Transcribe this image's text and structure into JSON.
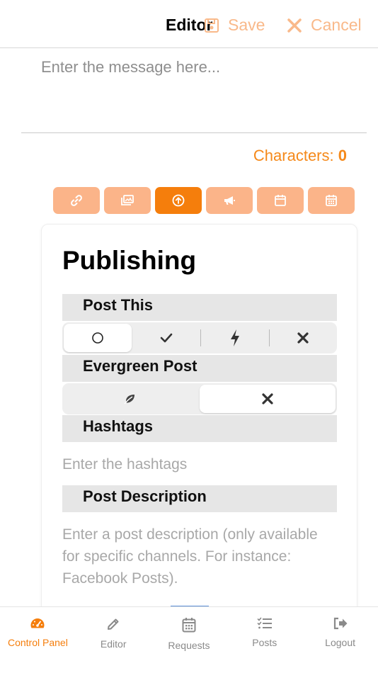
{
  "header": {
    "title": "Editor",
    "save_label": "Save",
    "cancel_label": "Cancel"
  },
  "message": {
    "placeholder": "Enter the message here...",
    "value": ""
  },
  "characters": {
    "label": "Characters:",
    "count": "0"
  },
  "toolbar": {
    "buttons": [
      "link-icon",
      "images-icon",
      "upload-icon",
      "bullhorn-icon",
      "calendar-icon",
      "calendar-grid-icon"
    ],
    "active_index": 2
  },
  "publishing": {
    "title": "Publishing",
    "post_this": {
      "label": "Post This",
      "options": [
        "circle-icon",
        "check-icon",
        "bolt-icon",
        "x-icon"
      ],
      "selected": "circle-icon"
    },
    "evergreen": {
      "label": "Evergreen Post",
      "options": [
        "leaf-icon",
        "x-icon"
      ],
      "selected": "x-icon"
    },
    "hashtags": {
      "label": "Hashtags",
      "placeholder": "Enter the hashtags",
      "value": ""
    },
    "description": {
      "label": "Post Description",
      "placeholder": "Enter a post description (only available for specific channels. For instance: Facebook Posts).",
      "value": ""
    }
  },
  "nav": {
    "items": [
      {
        "label": "Control Panel",
        "icon": "dashboard-icon",
        "active": true
      },
      {
        "label": "Editor",
        "icon": "pencil-icon",
        "active": false
      },
      {
        "label": "Requests",
        "icon": "calendar-icon",
        "active": false
      },
      {
        "label": "Posts",
        "icon": "checklist-icon",
        "active": false
      },
      {
        "label": "Logout",
        "icon": "logout-icon",
        "active": false
      }
    ]
  },
  "colors": {
    "accent": "#f57e0c",
    "accent_light": "#fbb489",
    "muted_accent": "#f9b98a"
  }
}
